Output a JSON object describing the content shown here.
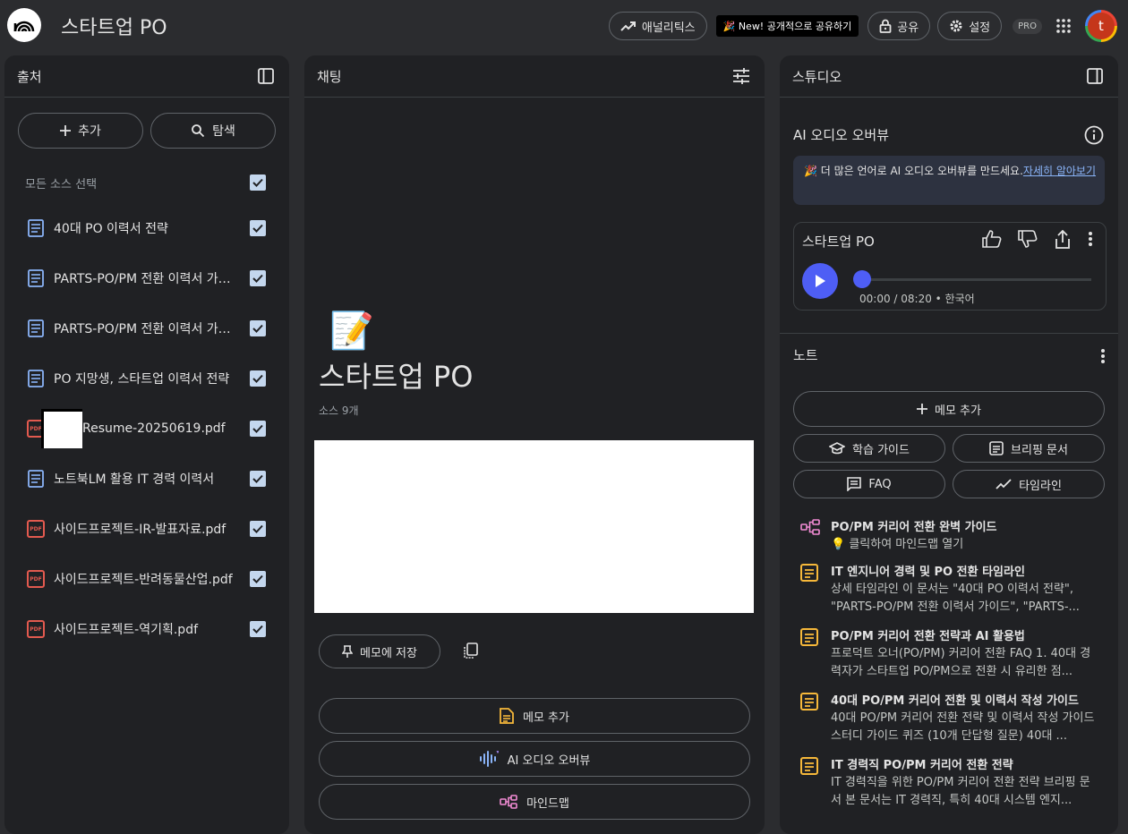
{
  "app": {
    "title": "스타트업 PO"
  },
  "header": {
    "analytics_label": "애널리틱스",
    "new_badge": "🎉 New! 공개적으로 공유하기",
    "share_label": "공유",
    "settings_label": "설정",
    "pro_label": "PRO",
    "avatar_letter": "t"
  },
  "sources": {
    "title": "출처",
    "add_label": "추가",
    "explore_label": "탐색",
    "select_all_label": "모든 소스 선택",
    "items": [
      {
        "label": "40대 PO 이력서 전략",
        "icon": "doc-icon"
      },
      {
        "label": "PARTS-PO/PM 전환 이력서 가이드",
        "icon": "doc-icon"
      },
      {
        "label": "PARTS-PO/PM 전환 이력서 가이...",
        "icon": "doc-icon"
      },
      {
        "label": "PO 지망생, 스타트업 이력서 전략",
        "icon": "doc-icon"
      },
      {
        "label": "Resume-20250619.pdf",
        "icon": "pdf-icon"
      },
      {
        "label": "노트북LM 활용 IT 경력 이력서",
        "icon": "doc-icon"
      },
      {
        "label": "사이드프로젝트-IR-발표자료.pdf",
        "icon": "pdf-icon"
      },
      {
        "label": "사이드프로젝트-반려동물산업.pdf",
        "icon": "pdf-icon"
      },
      {
        "label": "사이드프로젝트-역기획.pdf",
        "icon": "pdf-icon"
      }
    ]
  },
  "chat": {
    "title": "채팅",
    "emoji": "📝",
    "notebook_title": "스타트업 PO",
    "source_count": "소스 9개",
    "save_note_label": "메모에 저장",
    "actions": [
      "메모 추가",
      "AI 오디오 오버뷰",
      "마인드맵"
    ]
  },
  "studio": {
    "title": "스튜디오",
    "audio_section_title": "AI 오디오 오버뷰",
    "banner_text": "더 많은 언어로 AI 오디오 오버뷰를 만드세요.",
    "banner_link": "자세히 알아보기",
    "audio_title": "스타트업 PO",
    "audio_time": "00:00 / 08:20 • 한국어",
    "audio_progress": 0,
    "notes_title": "노트",
    "add_memo_label": "메모 추가",
    "tools": [
      "학습 가이드",
      "브리핑 문서",
      "FAQ",
      "타임라인"
    ],
    "notes": [
      {
        "title": "PO/PM 커리어 전환 완벽 가이드",
        "body": "💡 클릭하여 마인드맵 열기",
        "icon": "mindmap-icon"
      },
      {
        "title": "IT 엔지니어 경력 및 PO 전환 타임라인",
        "body": "상세 타임라인 이 문서는 \"40대 PO 이력서 전략\", \"PARTS-PO/PM 전환 이력서 가이드\", \"PARTS-...",
        "icon": "note-icon"
      },
      {
        "title": "PO/PM 커리어 전환 전략과 AI 활용법",
        "body": "프로덕트 오너(PO/PM) 커리어 전환 FAQ 1. 40대 경력자가 스타트업 PO/PM으로 전환 시 유리한 점...",
        "icon": "note-icon"
      },
      {
        "title": "40대 PO/PM 커리어 전환 및 이력서 작성 가이드",
        "body": "40대 PO/PM 커리어 전환 전략 및 이력서 작성 가이드 스터디 가이드 퀴즈 (10개 단답형 질문) 40대 ...",
        "icon": "note-icon"
      },
      {
        "title": "IT 경력직 PO/PM 커리어 전환 전략",
        "body": "IT 경력직을 위한 PO/PM 커리어 전환 전략 브리핑 문서 본 문서는 IT 경력직, 특히 40대 시스템 엔지...",
        "icon": "note-icon"
      }
    ]
  }
}
